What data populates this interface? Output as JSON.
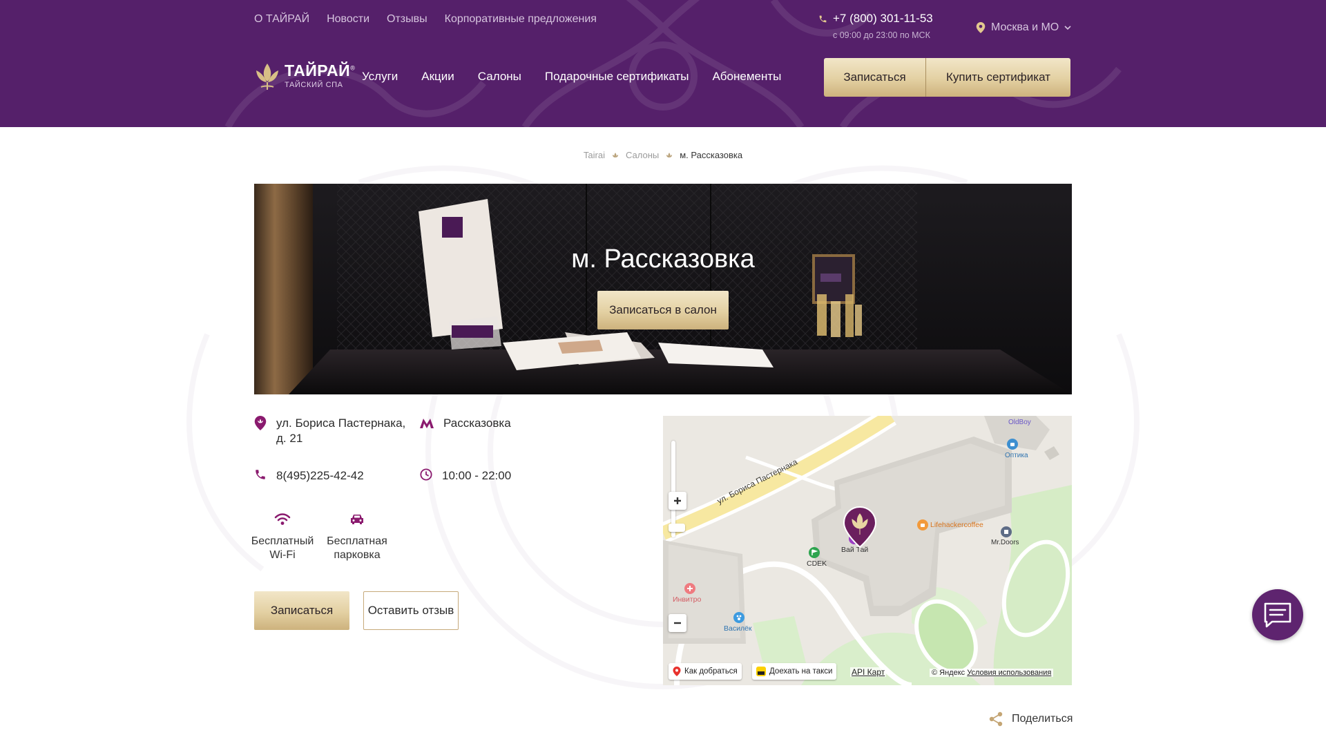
{
  "header": {
    "top_links": [
      "О ТАЙРАЙ",
      "Новости",
      "Отзывы",
      "Корпоративные предложения"
    ],
    "phone": "+7 (800) 301-11-53",
    "phone_hours": "с 09:00 до 23:00 по МСК",
    "city": "Москва и МО",
    "logo": {
      "name": "ТАЙРАЙ",
      "tagline": "ТАЙСКИЙ СПА",
      "mark": "®"
    },
    "main_nav": [
      "Услуги",
      "Акции",
      "Салоны",
      "Подарочные сертификаты",
      "Абонементы"
    ],
    "book_label": "Записаться",
    "buy_cert_label": "Купить сертификат"
  },
  "breadcrumb": [
    "Tairai",
    "Салоны",
    "м. Рассказовка"
  ],
  "hero": {
    "title": "м. Рассказовка",
    "button": "Записаться в салон"
  },
  "salon": {
    "address": "ул. Бориса Пастернака, д. 21",
    "metro": "Рассказовка",
    "phone": "8(495)225-42-42",
    "hours": "10:00 - 22:00",
    "features": [
      "Бесплатный Wi-Fi",
      "Бесплатная парковка"
    ],
    "book_label": "Записаться",
    "review_label": "Оставить отзыв"
  },
  "map": {
    "street": "ул. Бориса Пастернака",
    "pois": {
      "oldboy": "OldBoy",
      "optika": "Оптика",
      "lifehacker": "Lifehackercoffee",
      "mrdoors": "Mr.Doors",
      "vaitai": "Вай Тай",
      "cdek": "CDEK",
      "invitro": "Инвитро",
      "vasilek": "Василёк"
    },
    "route_label": "Как добраться",
    "taxi_label": "Доехать на такси",
    "api_label": "API Карт",
    "copyright": "© Яндекс",
    "terms": "Условия использования"
  },
  "share_label": "Поделиться",
  "colors": {
    "brand_purple": "#55206a",
    "gold": "#e3d0a2",
    "pin": "#6b1f5e"
  }
}
